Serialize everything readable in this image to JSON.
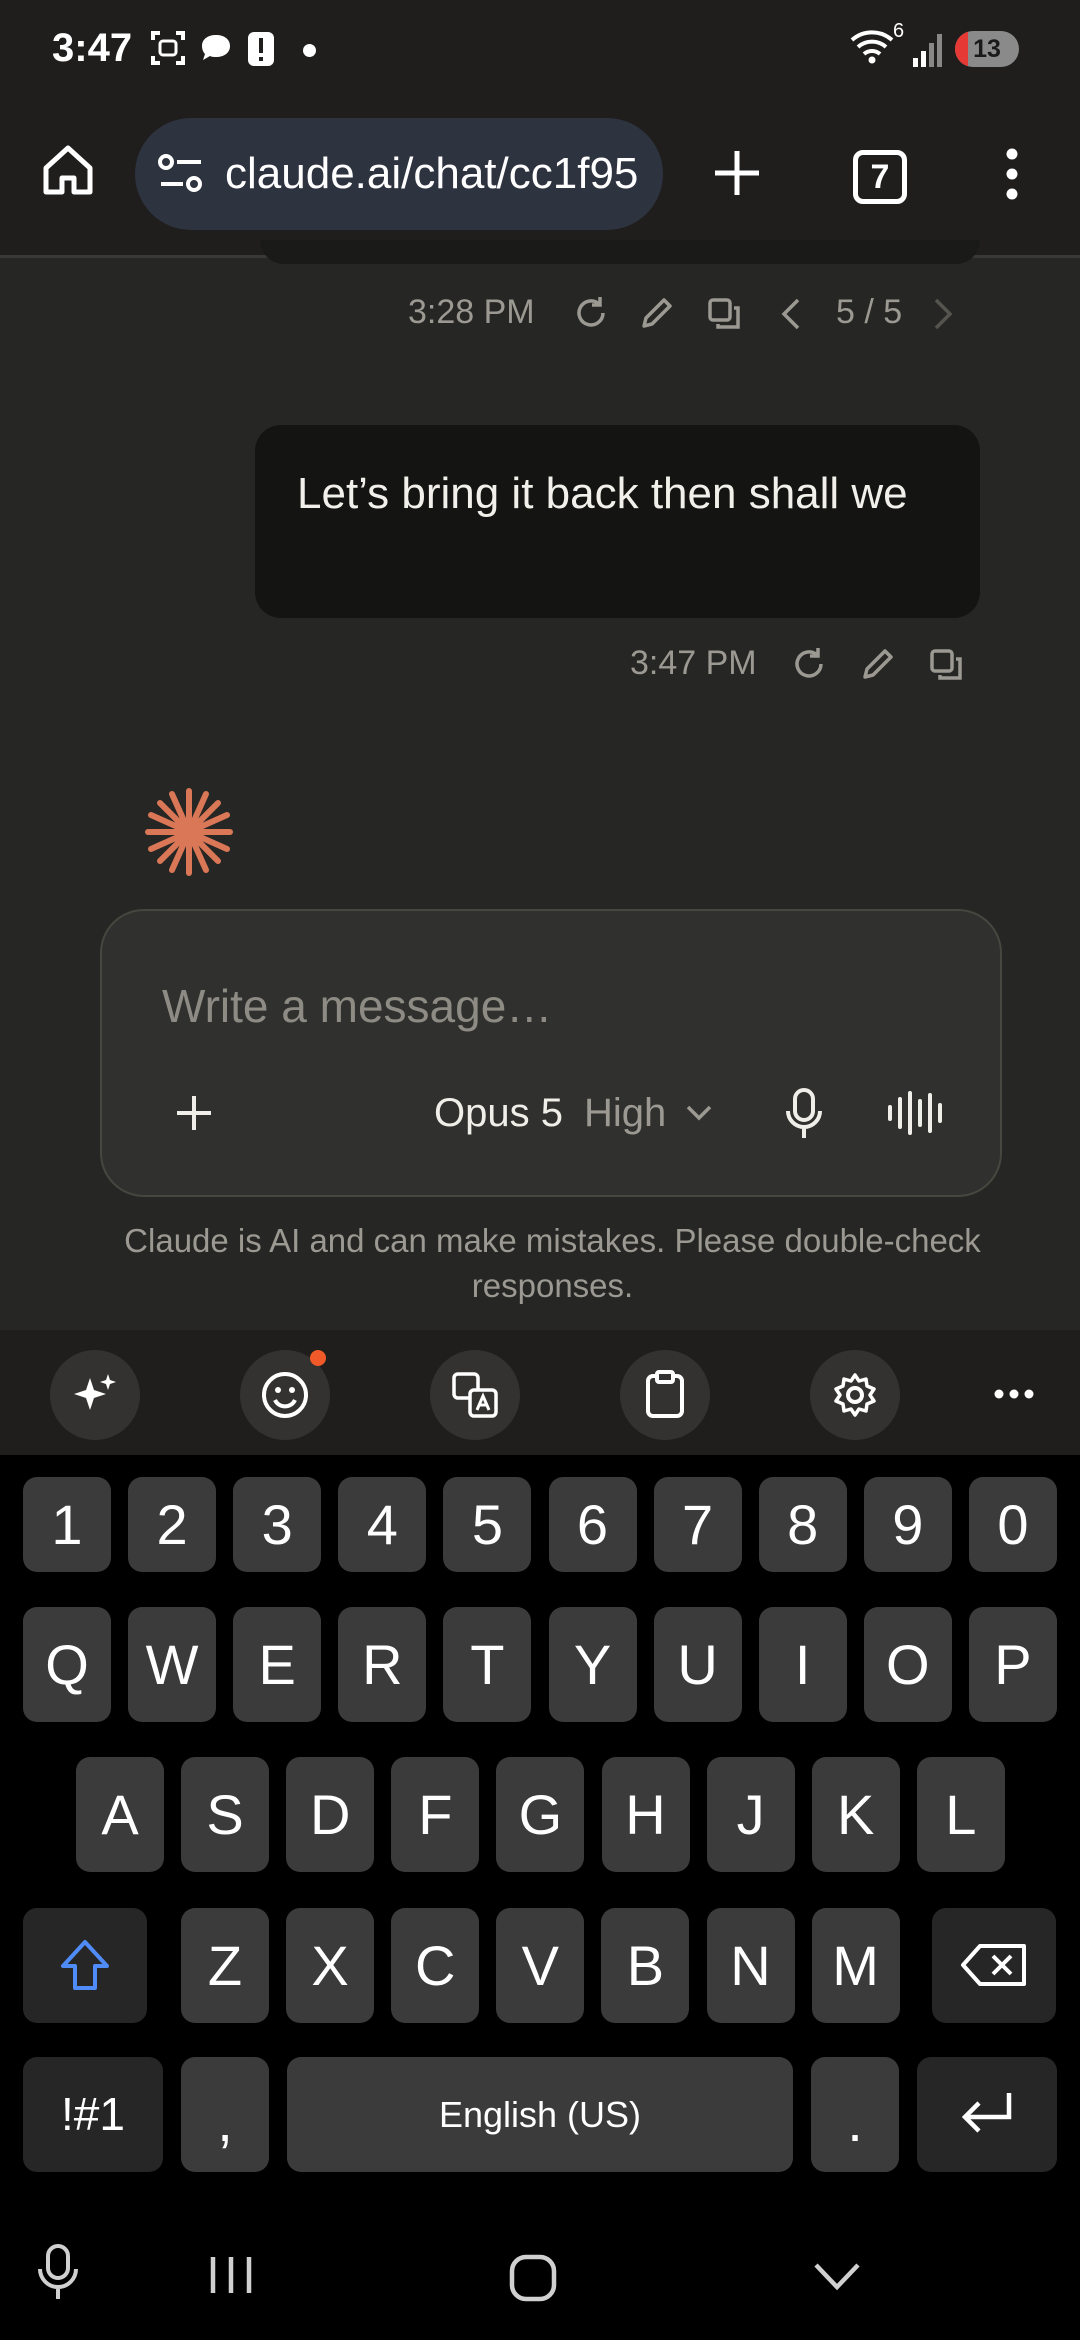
{
  "status_bar": {
    "time": "3:47",
    "wifi_label": "6",
    "battery_level": "13",
    "icons": [
      "screenshot-icon",
      "chat-bubble-icon",
      "alert-icon",
      "dot-icon",
      "wifi-icon",
      "signal-icon",
      "battery-icon"
    ]
  },
  "browser": {
    "url": "claude.ai/chat/cc1f95",
    "tab_count": "7"
  },
  "chat": {
    "prev_meta": {
      "time": "3:28 PM",
      "pager": "5 / 5"
    },
    "user_message": {
      "text": "Let’s bring it back then shall we",
      "time": "3:47 PM"
    },
    "accent_color": "#d97757"
  },
  "composer": {
    "placeholder": "Write a message…",
    "model": "Opus 5",
    "effort": "High",
    "disclaimer": "Claude is AI and can make mistakes. Please double-check responses."
  },
  "keyboard": {
    "row_numbers": [
      "1",
      "2",
      "3",
      "4",
      "5",
      "6",
      "7",
      "8",
      "9",
      "0"
    ],
    "row_q": [
      "Q",
      "W",
      "E",
      "R",
      "T",
      "Y",
      "U",
      "I",
      "O",
      "P"
    ],
    "row_a": [
      "A",
      "S",
      "D",
      "F",
      "G",
      "H",
      "J",
      "K",
      "L"
    ],
    "row_z": [
      "Z",
      "X",
      "C",
      "V",
      "B",
      "N",
      "M"
    ],
    "symbols_key": "!#1",
    "comma_key": ",",
    "space_label": "English (US)",
    "period_key": ".",
    "shift_color": "#4f8cf7"
  }
}
